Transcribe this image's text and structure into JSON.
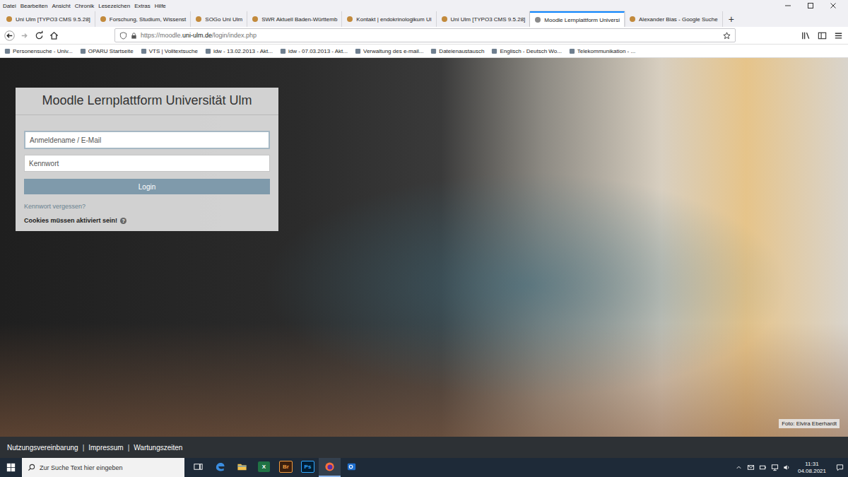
{
  "menu": [
    "Datei",
    "Bearbeiten",
    "Ansicht",
    "Chronik",
    "Lesezeichen",
    "Extras",
    "Hilfe"
  ],
  "tabs": [
    {
      "label": "Uni Ulm [TYPO3 CMS 9.5.28]",
      "selected": false
    },
    {
      "label": "Forschung, Studium, Wissenst",
      "selected": false
    },
    {
      "label": "SOGo Uni Ulm",
      "selected": false
    },
    {
      "label": "SWR Aktuell Baden-Württemb",
      "selected": false
    },
    {
      "label": "Kontakt | endokrinologikum Ul",
      "selected": false
    },
    {
      "label": "Uni Ulm [TYPO3 CMS 9.5.28]",
      "selected": false
    },
    {
      "label": "Moodle Lernplattform Universi",
      "selected": true
    },
    {
      "label": "Alexander Bias - Google Suche",
      "selected": false
    }
  ],
  "new_tab": "+",
  "address_bar": {
    "prefix": "https://moodle.",
    "domain": "uni-ulm.de",
    "path": "/login/index.php"
  },
  "bookmarks": [
    "Personensuche - Univ...",
    "OPARU Startseite",
    "VTS | Volltextsuche",
    "idw - 13.02.2013 - Akt...",
    "idw - 07.03.2013 - Akt...",
    "Verwaltung des e-mail...",
    "Dateienaustausch",
    "Englisch - Deutsch Wo...",
    "Telekommunikation - ..."
  ],
  "login": {
    "title": "Moodle Lernplattform Universität Ulm",
    "username_placeholder": "Anmeldename / E-Mail",
    "password_placeholder": "Kennwort",
    "button": "Login",
    "forgot": "Kennwort vergessen?",
    "cookies": "Cookies müssen aktiviert sein!",
    "help": "?"
  },
  "photo_credit": "Foto: Elvira Eberhardt",
  "footer": {
    "links": [
      "Nutzungsvereinbarung",
      "Impressum",
      "Wartungszeiten"
    ],
    "separator": "|"
  },
  "taskbar": {
    "search_placeholder": "Zur Suche Text hier eingeben",
    "apps": [
      {
        "kind": "taskview",
        "label": "",
        "active": false
      },
      {
        "kind": "edge",
        "label": "",
        "active": false
      },
      {
        "kind": "explorer",
        "label": "",
        "active": false
      },
      {
        "kind": "excel",
        "label": "X",
        "active": false
      },
      {
        "kind": "bridge",
        "label": "Br",
        "active": false
      },
      {
        "kind": "photoshop",
        "label": "Ps",
        "active": false
      },
      {
        "kind": "firefox",
        "label": "",
        "active": true
      },
      {
        "kind": "outlook",
        "label": "",
        "active": false
      }
    ],
    "time": "11:31",
    "date": "04.08.2021"
  }
}
